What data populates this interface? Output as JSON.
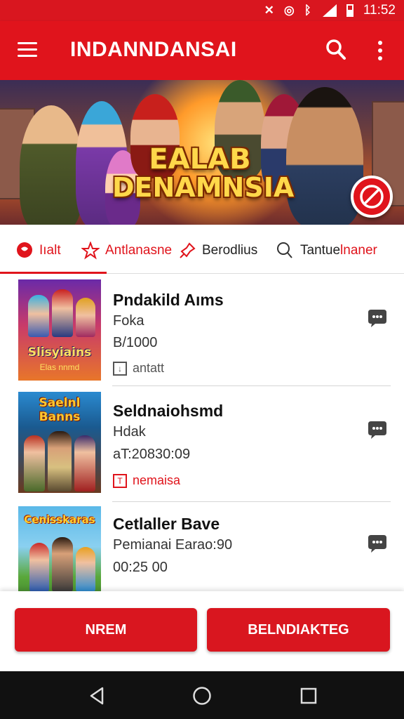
{
  "colors": {
    "brand": "#e0141c",
    "status_bar": "#d9161f",
    "nav_bar": "#111111"
  },
  "status": {
    "time": "11:52"
  },
  "app_bar": {
    "title": "INDANNDANSAI",
    "icons": [
      "menu-icon",
      "search-icon",
      "more-vertical-icon"
    ]
  },
  "banner": {
    "title_line1": "EALAB",
    "title_line2": "DENAMNSIA"
  },
  "tabs": [
    {
      "label": "Iıalt",
      "icon": "chat-bubble-icon",
      "active": true
    },
    {
      "label": "Antlanasne",
      "icon": "star-outline-icon",
      "active": false
    },
    {
      "label": "Berodlius",
      "icon": "pin-icon",
      "active": false
    },
    {
      "label_black": "Tantue",
      "label_red": "lnaner",
      "icon": "search-icon",
      "active": false
    }
  ],
  "list": [
    {
      "title": "Pndakild Aıms",
      "line1": "Foka",
      "line2": "B/1000",
      "tag": "antatt",
      "tag_style": "gray",
      "thumb_text": "Slisyiains",
      "thumb_sub": "Elas nnmd"
    },
    {
      "title": "Seldnaiohsmd",
      "line1": "Hdak",
      "line2": "aT:20830:09",
      "tag": "nemaisa",
      "tag_style": "red",
      "thumb_text": "Saelnl Banns",
      "thumb_sub": ""
    },
    {
      "title": "Cetlaller Bave",
      "line1": "Pemianai Earao:90",
      "line2": "00:25 00",
      "tag": "",
      "tag_style": "",
      "thumb_text": "Cenisskaras",
      "thumb_sub": ""
    }
  ],
  "buttons": {
    "left": "NREM",
    "right": "BELNDIAKTEG"
  }
}
